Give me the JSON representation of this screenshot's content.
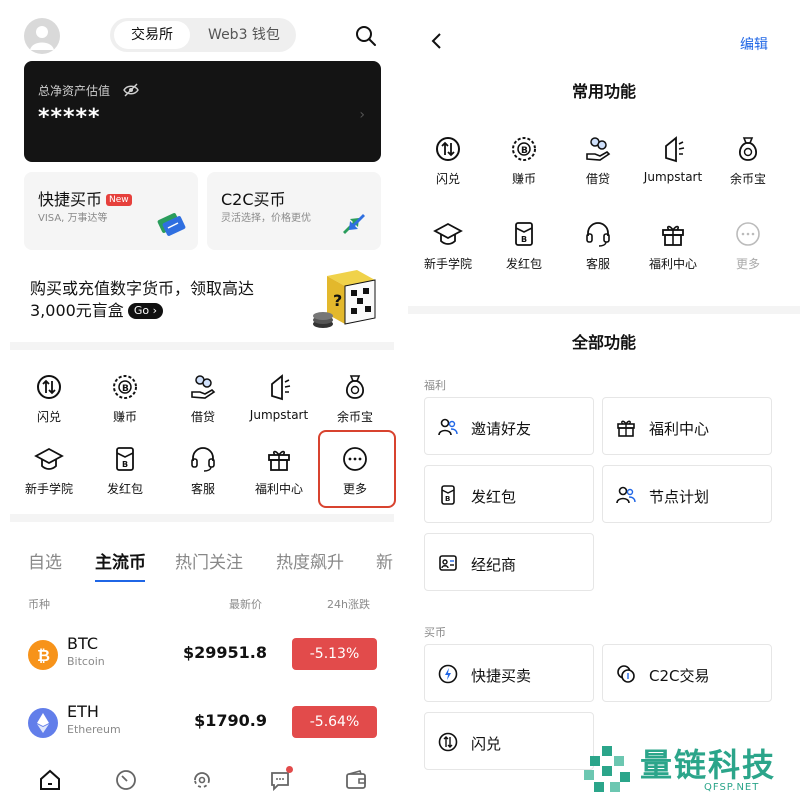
{
  "left": {
    "header": {
      "tabs": [
        {
          "label": "交易所",
          "active": true
        },
        {
          "label": "Web3 钱包",
          "active": false
        }
      ],
      "search_icon": "search-icon",
      "avatar_icon": "user-icon"
    },
    "asset": {
      "label": "总净资产估值",
      "value": "*****",
      "eye_icon": "eye-off-icon",
      "chevron": "›"
    },
    "buy_cards": [
      {
        "title": "快捷买币",
        "badge": "New",
        "sub": "VISA, 万事达等"
      },
      {
        "title": "C2C买币",
        "sub": "灵活选择，价格更优"
      }
    ],
    "promo": {
      "line1": "购买或充值数字货币，领取高达",
      "line2": "3,000元盲盒",
      "go": "Go"
    },
    "functions": [
      {
        "label": "闪兑",
        "icon": "swap-icon"
      },
      {
        "label": "赚币",
        "icon": "coin-icon"
      },
      {
        "label": "借贷",
        "icon": "loan-icon"
      },
      {
        "label": "Jumpstart",
        "icon": "jumpstart-icon"
      },
      {
        "label": "余币宝",
        "icon": "moneybag-icon"
      },
      {
        "label": "新手学院",
        "icon": "graduation-cap-icon"
      },
      {
        "label": "发红包",
        "icon": "red-packet-icon"
      },
      {
        "label": "客服",
        "icon": "headset-icon"
      },
      {
        "label": "福利中心",
        "icon": "gift-icon"
      },
      {
        "label": "更多",
        "icon": "more-icon"
      }
    ],
    "market_tabs": [
      {
        "label": "自选",
        "active": false
      },
      {
        "label": "主流币",
        "active": true
      },
      {
        "label": "热门关注",
        "active": false
      },
      {
        "label": "热度飙升",
        "active": false
      },
      {
        "label": "新",
        "active": false
      }
    ],
    "columns": {
      "coin": "币种",
      "price": "最新价",
      "change": "24h涨跌"
    },
    "coins": [
      {
        "symbol": "BTC",
        "name": "Bitcoin",
        "price": "$29951.8",
        "change": "-5.13%",
        "color": "#f7931a"
      },
      {
        "symbol": "ETH",
        "name": "Ethereum",
        "price": "$1790.9",
        "change": "-5.64%",
        "color": "#627eea"
      }
    ],
    "bottom_nav": [
      "home-icon",
      "markets-icon",
      "trade-icon",
      "chat-icon",
      "wallet-icon"
    ]
  },
  "right": {
    "header": {
      "back_icon": "back-icon",
      "edit": "编辑"
    },
    "common_title": "常用功能",
    "common": [
      {
        "label": "闪兑",
        "icon": "swap-icon"
      },
      {
        "label": "赚币",
        "icon": "coin-icon"
      },
      {
        "label": "借贷",
        "icon": "loan-icon"
      },
      {
        "label": "Jumpstart",
        "icon": "jumpstart-icon"
      },
      {
        "label": "余币宝",
        "icon": "moneybag-icon"
      },
      {
        "label": "新手学院",
        "icon": "graduation-cap-icon"
      },
      {
        "label": "发红包",
        "icon": "red-packet-icon"
      },
      {
        "label": "客服",
        "icon": "headset-icon"
      },
      {
        "label": "福利中心",
        "icon": "gift-icon"
      },
      {
        "label": "更多",
        "icon": "more-icon"
      }
    ],
    "all_title": "全部功能",
    "groups": [
      {
        "label": "福利",
        "items": [
          {
            "label": "邀请好友",
            "icon": "users-icon"
          },
          {
            "label": "福利中心",
            "icon": "gift-icon"
          },
          {
            "label": "发红包",
            "icon": "red-packet-icon"
          },
          {
            "label": "节点计划",
            "icon": "users-icon"
          },
          {
            "label": "经纪商",
            "icon": "broker-icon"
          }
        ]
      },
      {
        "label": "买币",
        "items": [
          {
            "label": "快捷买卖",
            "icon": "lightning-icon"
          },
          {
            "label": "C2C交易",
            "icon": "c2c-icon"
          },
          {
            "label": "闪兑",
            "icon": "swap-icon"
          }
        ]
      }
    ]
  },
  "watermark": {
    "text": "量链科技",
    "sub": "QFSP.NET",
    "color": "#2ba58a"
  }
}
